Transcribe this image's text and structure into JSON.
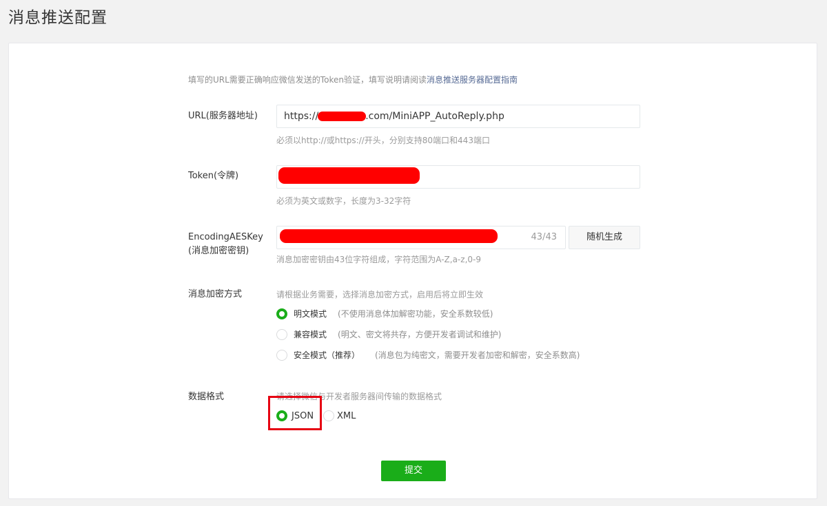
{
  "page": {
    "title": "消息推送配置"
  },
  "intro": {
    "text": "填写的URL需要正确响应微信发送的Token验证，填写说明请阅读",
    "link": "消息推送服务器配置指南"
  },
  "url_field": {
    "label": "URL(服务器地址)",
    "value_prefix": "https://",
    "value_suffix": ".com/MiniAPP_AutoReply.php",
    "tip": "必须以http://或https://开头，分别支持80端口和443端口"
  },
  "token_field": {
    "label": "Token(令牌)",
    "tip": "必须为英文或数字，长度为3-32字符"
  },
  "aes_field": {
    "label_line1": "EncodingAESKey",
    "label_line2": "(消息加密密钥)",
    "counter": "43/43",
    "generate_button": "随机生成",
    "tip": "消息加密密钥由43位字符组成，字符范围为A-Z,a-z,0-9"
  },
  "encrypt_mode": {
    "label": "消息加密方式",
    "tip": "请根据业务需要，选择消息加密方式，启用后将立即生效",
    "options": [
      {
        "label": "明文模式",
        "desc": "(不使用消息体加解密功能，安全系数较低)",
        "checked": true
      },
      {
        "label": "兼容模式",
        "desc": "(明文、密文将共存，方便开发者调试和维护)",
        "checked": false
      },
      {
        "label": "安全模式（推荐）",
        "desc": "(消息包为纯密文，需要开发者加密和解密，安全系数高)",
        "checked": false
      }
    ]
  },
  "data_format": {
    "label": "数据格式",
    "tip": "请选择微信与开发者服务器间传输的数据格式",
    "options": [
      {
        "label": "JSON",
        "checked": true
      },
      {
        "label": "XML",
        "checked": false
      }
    ]
  },
  "submit": {
    "label": "提交"
  },
  "colors": {
    "accent": "#1aad19",
    "link": "#576b95",
    "highlight": "#e60012",
    "redaction": "#ff0000"
  }
}
